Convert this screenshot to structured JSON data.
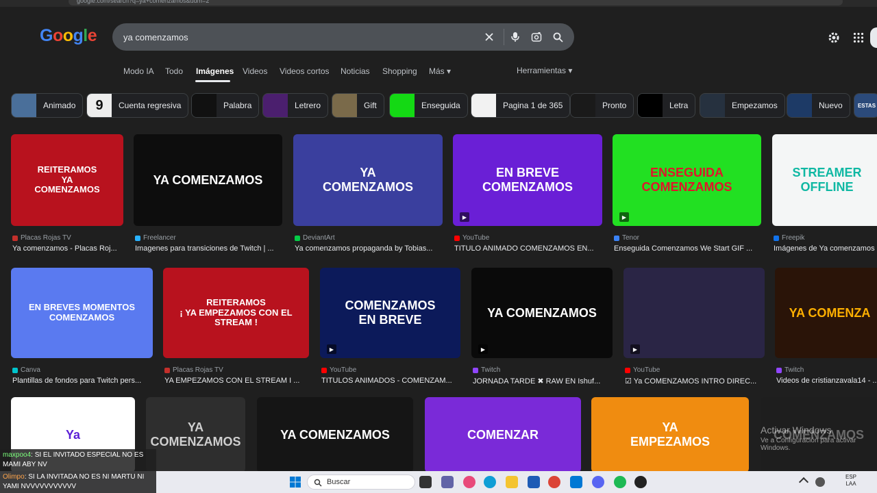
{
  "browser": {
    "url": "google.com/search?q=ya+comenzamos&udm=2"
  },
  "logo": {
    "letters": [
      "G",
      "o",
      "o",
      "g",
      "l",
      "e"
    ]
  },
  "search": {
    "query": "ya comenzamos"
  },
  "tabs": [
    {
      "label": "Modo IA"
    },
    {
      "label": "Todo"
    },
    {
      "label": "Imágenes",
      "active": true
    },
    {
      "label": "Videos"
    },
    {
      "label": "Videos cortos"
    },
    {
      "label": "Noticias"
    },
    {
      "label": "Shopping"
    },
    {
      "label": "Más ▾"
    }
  ],
  "tools": {
    "label": "Herramientas ▾"
  },
  "chips": [
    {
      "label": "Animado",
      "color": "#4a6f9a"
    },
    {
      "label": "Cuenta regresiva",
      "color": "#ededed",
      "thumb_text": "9"
    },
    {
      "label": "Palabra",
      "color": "#111111"
    },
    {
      "label": "Letrero",
      "color": "#4b1f6e"
    },
    {
      "label": "Gift",
      "color": "#7a6a4a"
    },
    {
      "label": "Enseguida",
      "color": "#14d914"
    },
    {
      "label": "Pagina 1 de 365",
      "color": "#f2f2f2"
    },
    {
      "label": "Pronto",
      "color": "#1a1a1a"
    },
    {
      "label": "Letra",
      "color": "#000000"
    },
    {
      "label": "Empezamos",
      "color": "#26313f"
    },
    {
      "label": "Nuevo",
      "color": "#1d3a66"
    },
    {
      "label": "ESTAS",
      "color": "#2b4a7a"
    }
  ],
  "rows": [
    [
      {
        "text": "REITERAMOS\nYA\nCOMENZAMOS",
        "bg": "#b8121e",
        "fg": "#ffffff",
        "source": "Placas Rojas TV",
        "fav": "#c4302b",
        "title": "Ya comenzamos - Placas Roj...",
        "play": false
      },
      {
        "text": "YA COMENZAMOS",
        "bg": "#0d0d0d",
        "fg": "#ffffff",
        "source": "Freelancer",
        "fav": "#29b2fe",
        "title": "Imagenes para transiciones de Twitch | ...",
        "play": false
      },
      {
        "text": "YA\nCOMENZAMOS",
        "bg": "#3a3f9e",
        "fg": "#ffffff",
        "source": "DeviantArt",
        "fav": "#05cc47",
        "title": "Ya comenzamos propaganda by Tobias...",
        "play": false
      },
      {
        "text": "EN BREVE\nCOMENZAMOS",
        "bg": "#6a1fd6",
        "fg": "#ffffff",
        "source": "YouTube",
        "fav": "#ff0000",
        "title": "TITULO ANIMADO COMENZAMOS EN...",
        "play": true
      },
      {
        "text": "ENSEGUIDA\nCOMENZAMOS",
        "bg": "#22e022",
        "fg": "#e0162b",
        "source": "Tenor",
        "fav": "#3b82f6",
        "title": "Enseguida Comenzamos We Start GIF ...",
        "play": true
      },
      {
        "text": "STREAMER\nOFFLINE",
        "bg": "#f4f6f6",
        "fg": "#0fb8a3",
        "source": "Freepik",
        "fav": "#1273eb",
        "title": "Imágenes de Ya comenzamos",
        "play": false
      }
    ],
    [
      {
        "text": "EN BREVES MOMENTOS\nCOMENZAMOS",
        "bg": "#5a7af0",
        "fg": "#ffffff",
        "source": "Canva",
        "fav": "#00c4cc",
        "title": "Plantillas de fondos para Twitch pers...",
        "play": false
      },
      {
        "text": "REITERAMOS\n¡ YA EMPEZAMOS CON EL\nSTREAM !",
        "bg": "#b8121e",
        "fg": "#ffffff",
        "source": "Placas Rojas TV",
        "fav": "#c4302b",
        "title": "YA EMPEZAMOS CON EL STREAM I ...",
        "play": false
      },
      {
        "text": "COMENZAMOS\nEN BREVE",
        "bg": "#0c1a5a",
        "fg": "#ffffff",
        "source": "YouTube",
        "fav": "#ff0000",
        "title": "TITULOS ANIMADOS - COMENZAM...",
        "play": true
      },
      {
        "text": "YA COMENZAMOS",
        "bg": "#0a0a0a",
        "fg": "#ffffff",
        "source": "Twitch",
        "fav": "#9146ff",
        "title": "JORNADA TARDE ✖ RAW EN Ishuf...",
        "play": true
      },
      {
        "text": "",
        "bg": "#2a2545",
        "fg": "#ffffff",
        "source": "YouTube",
        "fav": "#ff0000",
        "title": "☑ Ya COMENZAMOS INTRO DIREC...",
        "play": true
      },
      {
        "text": "YA COMENZA",
        "bg": "#2a1408",
        "fg": "#ffb000",
        "source": "Twitch",
        "fav": "#9146ff",
        "title": "Videos de cristianzavala14 - ...",
        "play": false
      }
    ],
    [
      {
        "text": "Ya",
        "bg": "#ffffff",
        "fg": "#5b1fd6"
      },
      {
        "text": "YA COMENZAMOS",
        "bg": "#2e2e2e",
        "fg": "#cfcfcf"
      },
      {
        "text": "YA COMENZAMOS",
        "bg": "#151515",
        "fg": "#ffffff"
      },
      {
        "text": "COMENZAR",
        "bg": "#7a2ad8",
        "fg": "#ffffff"
      },
      {
        "text": "YA\nEMPEZAMOS",
        "bg": "#f08c10",
        "fg": "#ffffff"
      },
      {
        "text": "COMENZAMOS",
        "bg": "#1e1e1e",
        "fg": "#6a6a6a"
      }
    ]
  ],
  "chat": [
    {
      "user": "maxpoo4",
      "text": ": SI EL INVITADO ESPECIAL NO ES MAMI ABY NV"
    },
    {
      "user": "Olimpo",
      "text": ": SI LA INVITADA NO ES NI MARTU NI YAMI NVVVVVVVVVVV"
    }
  ],
  "watermark": {
    "line1": "Activar Windows",
    "line2": "Ve a Configuración para activar Windows."
  },
  "taskbar": {
    "search_label": "Buscar",
    "lang": "ESP",
    "region": "LAA"
  }
}
